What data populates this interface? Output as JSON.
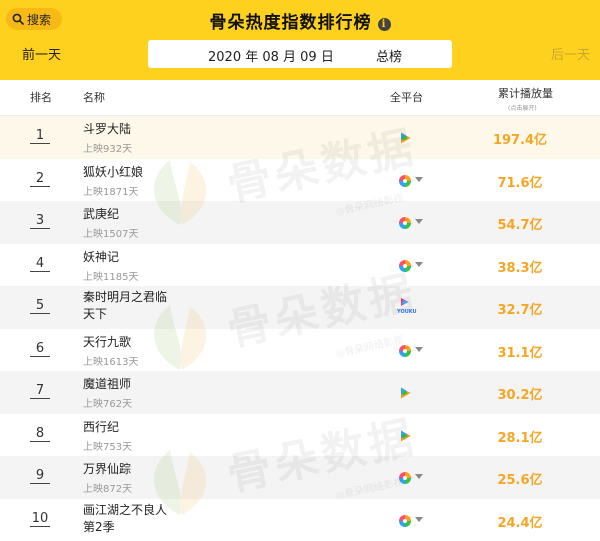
{
  "header": {
    "search_label": "搜索",
    "title": "骨朵热度指数排行榜",
    "info_glyph": "i",
    "prev_day": "前一天",
    "next_day": "后一天",
    "date": "2020 年 08 月 09 日",
    "board": "总榜"
  },
  "table": {
    "col_rank": "排名",
    "col_name": "名称",
    "col_platform": "全平台",
    "col_plays": "累计播放量",
    "col_plays_sub": "(点击展开)"
  },
  "watermark": {
    "brand": "骨朵数据",
    "sub": "◎骨朵网络影视"
  },
  "colors": {
    "header_bg": "#ffd11f",
    "accent_value": "#f5a623",
    "row_highlight": "#fdf8e9"
  },
  "rows": [
    {
      "rank": "1",
      "title": "斗罗大陆",
      "days": "上映932天",
      "platform": "tencent-video-icon",
      "plays": "197.4亿"
    },
    {
      "rank": "2",
      "title": "狐妖小红娘",
      "days": "上映1871天",
      "platform": "multi-platform-icon",
      "plays": "71.6亿"
    },
    {
      "rank": "3",
      "title": "武庚纪",
      "days": "上映1507天",
      "platform": "multi-platform-icon",
      "plays": "54.7亿"
    },
    {
      "rank": "4",
      "title": "妖神记",
      "days": "上映1185天",
      "platform": "multi-platform-icon",
      "plays": "38.3亿"
    },
    {
      "rank": "5",
      "title": "秦时明月之君临",
      "title2": "天下",
      "platform": "youku-icon",
      "platform_label": "YOUKU",
      "plays": "32.7亿"
    },
    {
      "rank": "6",
      "title": "天行九歌",
      "days": "上映1613天",
      "platform": "multi-platform-icon",
      "plays": "31.1亿"
    },
    {
      "rank": "7",
      "title": "魔道祖师",
      "days": "上映762天",
      "platform": "tencent-video-icon",
      "plays": "30.2亿"
    },
    {
      "rank": "8",
      "title": "西行纪",
      "days": "上映753天",
      "platform": "tencent-video-icon",
      "plays": "28.1亿"
    },
    {
      "rank": "9",
      "title": "万界仙踪",
      "days": "上映872天",
      "platform": "multi-platform-icon",
      "plays": "25.6亿"
    },
    {
      "rank": "10",
      "title": "画江湖之不良人",
      "title2": "第2季",
      "platform": "multi-platform-icon",
      "plays": "24.4亿"
    }
  ]
}
